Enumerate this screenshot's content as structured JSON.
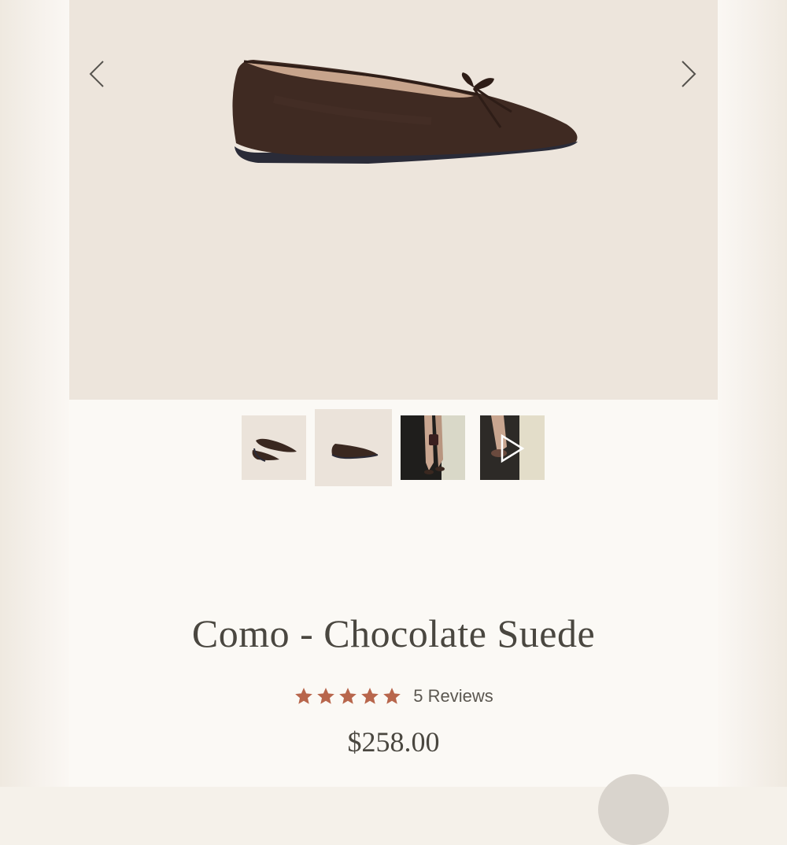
{
  "gallery": {
    "prev_icon": "chevron-left-icon",
    "next_icon": "chevron-right-icon",
    "background_color": "#ede5dc",
    "thumbnails": [
      {
        "icon": "shoe-pair-photo"
      },
      {
        "icon": "shoe-side-photo"
      },
      {
        "icon": "lifestyle-photo"
      },
      {
        "icon": "video-play-icon"
      }
    ]
  },
  "product": {
    "title": "Como - Chocolate Suede",
    "rating": 5,
    "rating_max": 5,
    "reviews_label": "5 Reviews",
    "price": "$258.00",
    "star_color": "#b8664c",
    "shoe_color": "#3f2a22"
  }
}
